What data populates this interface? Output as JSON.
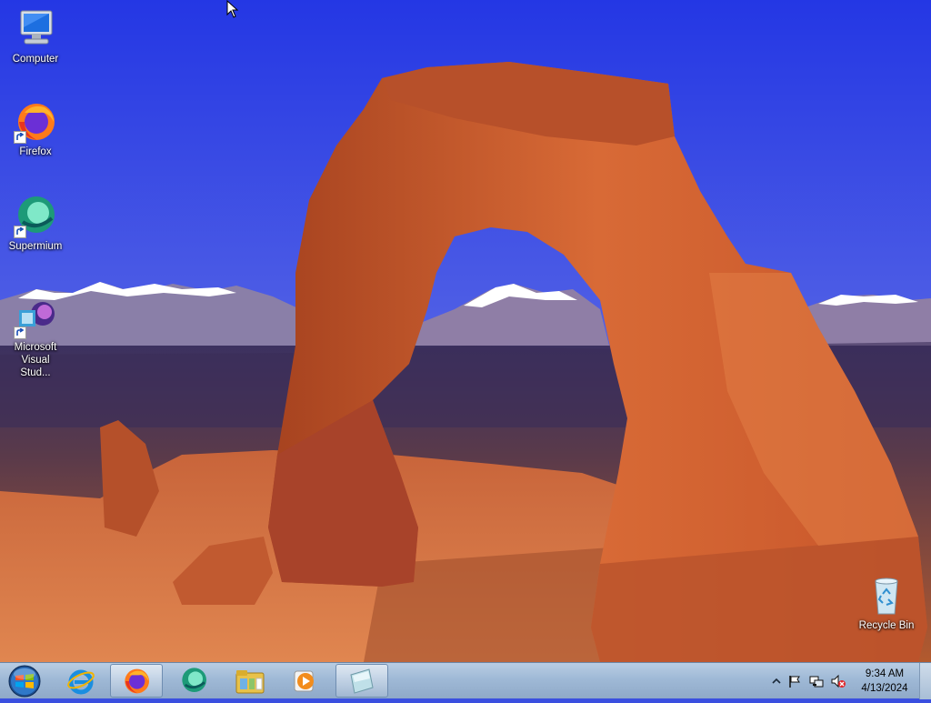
{
  "desktop": {
    "icons": [
      {
        "label": "Computer",
        "icon": "computer-icon"
      },
      {
        "label": "Firefox",
        "icon": "firefox-icon"
      },
      {
        "label": "Supermium",
        "icon": "supermium-icon"
      },
      {
        "label": "Microsoft Visual Stud...",
        "icon": "visual-studio-icon"
      },
      {
        "label": "Recycle Bin",
        "icon": "recycle-bin-icon"
      }
    ]
  },
  "taskbar": {
    "start_icon": "windows-start-orb-icon",
    "pinned": [
      {
        "name": "Internet Explorer",
        "icon": "internet-explorer-icon"
      },
      {
        "name": "Firefox",
        "icon": "firefox-icon",
        "active": true
      },
      {
        "name": "Supermium",
        "icon": "supermium-icon"
      },
      {
        "name": "Windows Explorer",
        "icon": "file-explorer-icon"
      },
      {
        "name": "Windows Media Player",
        "icon": "media-player-icon"
      },
      {
        "name": "Window",
        "icon": "window-icon",
        "active": true
      }
    ],
    "tray": {
      "icons": [
        "show-hidden-icons-chevron",
        "action-center-flag-icon",
        "network-icon",
        "volume-muted-icon"
      ],
      "time": "9:34 AM",
      "date": "4/13/2024"
    }
  },
  "colors": {
    "sky_top": "#2a3fe6",
    "sky_bottom": "#7b86e6",
    "rock": "#c8552a",
    "taskbar": "#a9c0da"
  }
}
